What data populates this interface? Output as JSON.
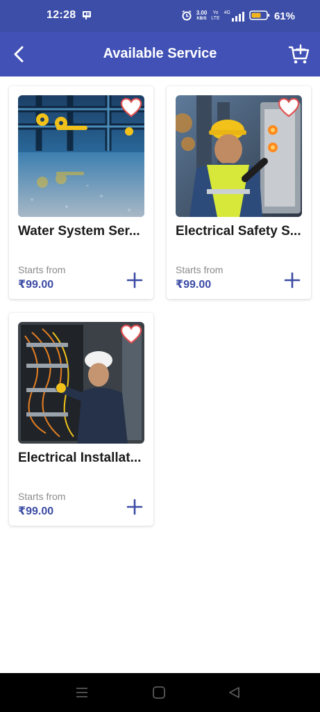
{
  "status_bar": {
    "time": "12:28",
    "speed_value": "3.00",
    "speed_unit": "KB/S",
    "volte_top": "Yo",
    "volte_bottom": "LTE",
    "network": "4G",
    "battery_percent": "61%"
  },
  "app_bar": {
    "title": "Available Service",
    "back_icon": "back-arrow-icon",
    "cart_icon": "add-to-cart-icon"
  },
  "services": [
    {
      "title": "Water System Ser...",
      "starts_label": "Starts from",
      "price": "₹99.00",
      "image": "water-system-photo"
    },
    {
      "title": "Electrical Safety S...",
      "starts_label": "Starts from",
      "price": "₹99.00",
      "image": "electrical-safety-photo"
    },
    {
      "title": "Electrical Installat...",
      "starts_label": "Starts from",
      "price": "₹99.00",
      "image": "electrical-installation-photo"
    }
  ],
  "colors": {
    "primary": "#4151b5",
    "status_bar": "#3c4ea8",
    "price": "#3b4ba5",
    "heart": "#e05050"
  },
  "nav_bar": {
    "menu_icon": "menu-icon",
    "home_icon": "home-icon",
    "back_icon": "back-triangle-icon"
  }
}
